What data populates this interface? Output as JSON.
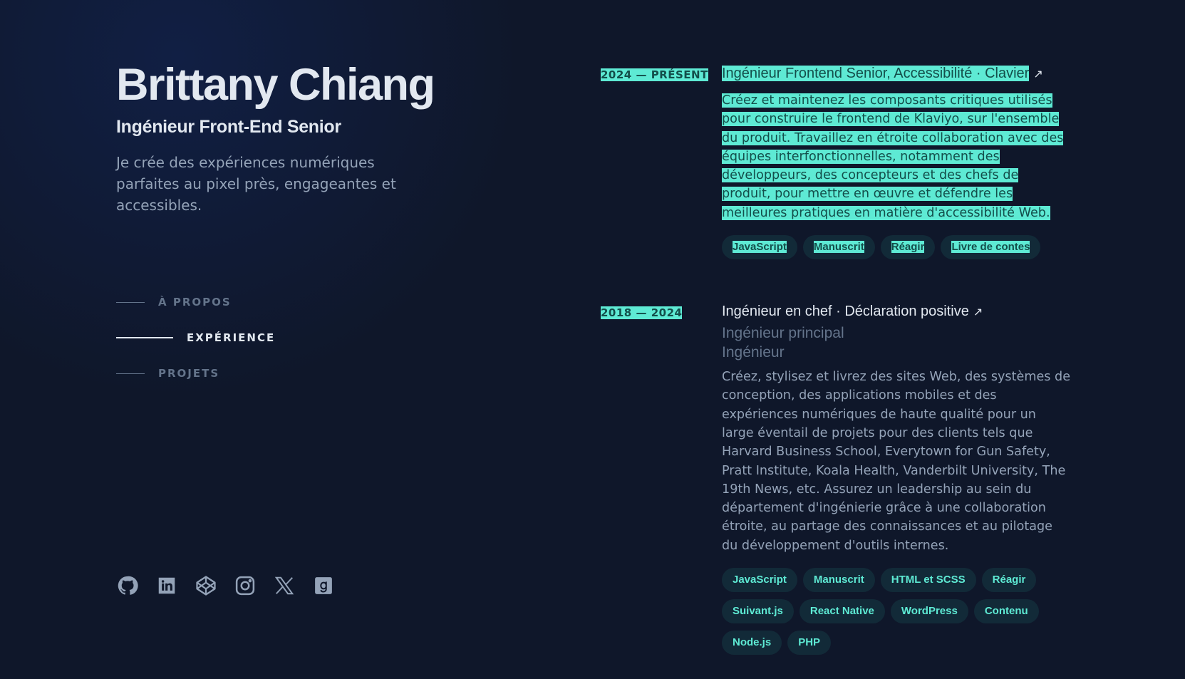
{
  "profile": {
    "name": "Brittany Chiang",
    "role": "Ingénieur Front-End Senior",
    "tagline": "Je crée des expériences numériques parfaites au pixel près, engageantes et accessibles."
  },
  "nav": {
    "about": "À PROPOS",
    "experience": "EXPÉRIENCE",
    "projects": "PROJETS"
  },
  "socials": [
    "github-icon",
    "linkedin-icon",
    "codepen-icon",
    "instagram-icon",
    "x-icon",
    "goodreads-icon"
  ],
  "jobs": [
    {
      "period": "2024 — PRÉSENT",
      "title": "Ingénieur Frontend Senior, Accessibilité · Clavier",
      "arrow": "↗",
      "subroles": [],
      "description": "Créez et maintenez les composants critiques utilisés pour construire le frontend de Klaviyo, sur l'ensemble du produit. Travaillez en étroite collaboration avec des équipes interfonctionnelles, notamment des développeurs, des concepteurs et des chefs de produit, pour mettre en œuvre et défendre les meilleures pratiques en matière d'accessibilité Web.",
      "tags": [
        "JavaScript",
        "Manuscrit",
        "Réagir",
        "Livre de contes"
      ]
    },
    {
      "period": "2018 — 2024",
      "title": "Ingénieur en chef · Déclaration positive",
      "arrow": "↗",
      "subroles": [
        "Ingénieur principal",
        "Ingénieur"
      ],
      "description": "Créez, stylisez et livrez des sites Web, des systèmes de conception, des applications mobiles et des expériences numériques de haute qualité pour un large éventail de projets pour des clients tels que Harvard Business School, Everytown for Gun Safety, Pratt Institute, Koala Health, Vanderbilt University, The 19th News, etc. Assurez un leadership au sein du département d'ingénierie grâce à une collaboration étroite, au partage des connaissances et au pilotage du développement d'outils internes.",
      "tags": [
        "JavaScript",
        "Manuscrit",
        "HTML et SCSS",
        "Réagir",
        "Suivant.js",
        "React Native",
        "WordPress",
        "Contenu",
        "Node.js",
        "PHP"
      ]
    }
  ],
  "colors": {
    "background": "#0f172a",
    "accent": "#5eead4",
    "highlight_text": "#134e4a"
  }
}
